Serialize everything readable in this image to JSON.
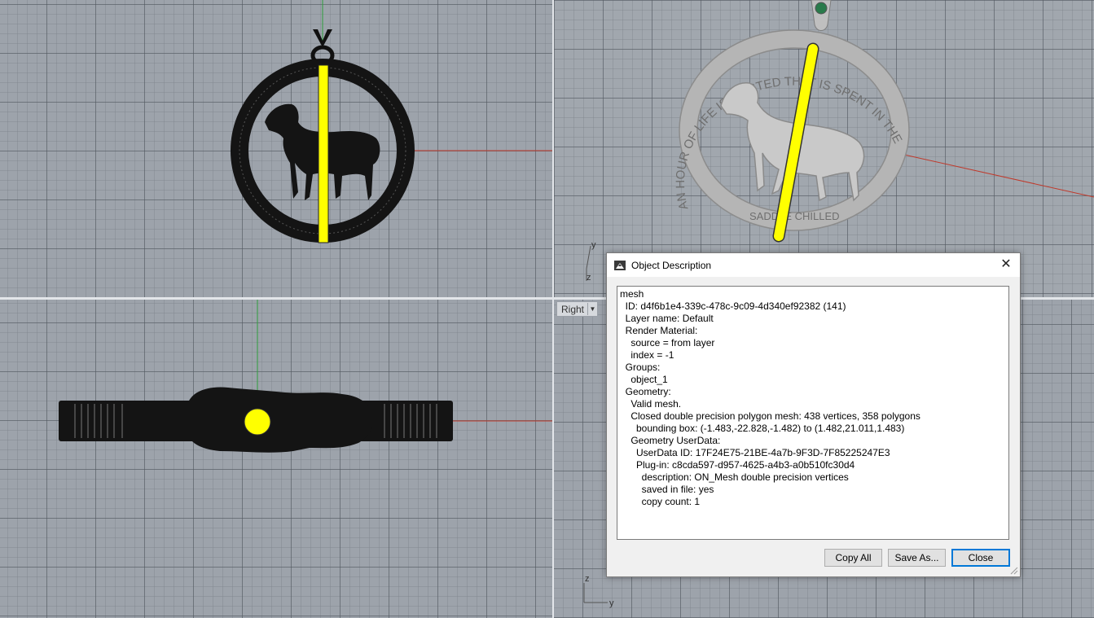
{
  "viewports": {
    "right_label": "Right"
  },
  "axis_labels": {
    "persp_y": "y",
    "persp_z": "z",
    "right_z": "z",
    "right_y": "y"
  },
  "pendant_text": {
    "inscription_top": "AN HOUR OF LIFE IS WASTED THAT IS SPENT IN THE",
    "inscription_bottom": "SADDLE  CHILLED"
  },
  "dialog": {
    "title": "Object Description",
    "lines": [
      "mesh",
      "  ID: d4f6b1e4-339c-478c-9c09-4d340ef92382 (141)",
      "  Layer name: Default",
      "  Render Material:",
      "    source = from layer",
      "    index = -1",
      "  Groups:",
      "    object_1",
      "  Geometry:",
      "    Valid mesh.",
      "    Closed double precision polygon mesh: 438 vertices, 358 polygons",
      "      bounding box: (-1.483,-22.828,-1.482) to (1.482,21.011,1.483)",
      "    Geometry UserData:",
      "      UserData ID: 17F24E75-21BE-4a7b-9F3D-7F85225247E3",
      "      Plug-in: c8cda597-d957-4625-a4b3-a0b510fc30d4",
      "        description: ON_Mesh double precision vertices",
      "        saved in file: yes",
      "        copy count: 1"
    ],
    "buttons": {
      "copy_all": "Copy All",
      "save_as": "Save As...",
      "close": "Close"
    }
  },
  "colors": {
    "highlight": "#ffff00",
    "x_axis": "#c0392b",
    "y_axis": "#2e9e3e",
    "default_button_border": "#0078d7"
  }
}
